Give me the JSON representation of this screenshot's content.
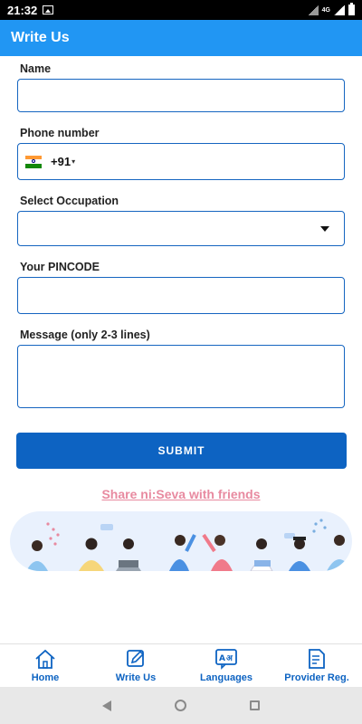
{
  "status_bar": {
    "time": "21:32",
    "network": "4G"
  },
  "app_bar": {
    "title": "Write Us"
  },
  "form": {
    "name_label": "Name",
    "name_value": "",
    "phone_label": "Phone number",
    "phone_dial_code": "+91",
    "phone_value": "",
    "occupation_label": "Select Occupation",
    "occupation_value": "",
    "pincode_label": "Your PINCODE",
    "pincode_value": "",
    "message_label": "Message (only 2-3 lines)",
    "message_value": ""
  },
  "submit_label": "SUBMIT",
  "share_link": "Share ni:Seva with friends",
  "bottom_nav": {
    "items": [
      {
        "label": "Home",
        "icon": "home-icon"
      },
      {
        "label": "Write Us",
        "icon": "edit-icon"
      },
      {
        "label": "Languages",
        "icon": "translate-icon"
      },
      {
        "label": "Provider Reg.",
        "icon": "form-icon"
      }
    ]
  },
  "colors": {
    "primary": "#2196f3",
    "button": "#0d63c2",
    "share": "#e88aa0",
    "border": "#1565c0"
  }
}
